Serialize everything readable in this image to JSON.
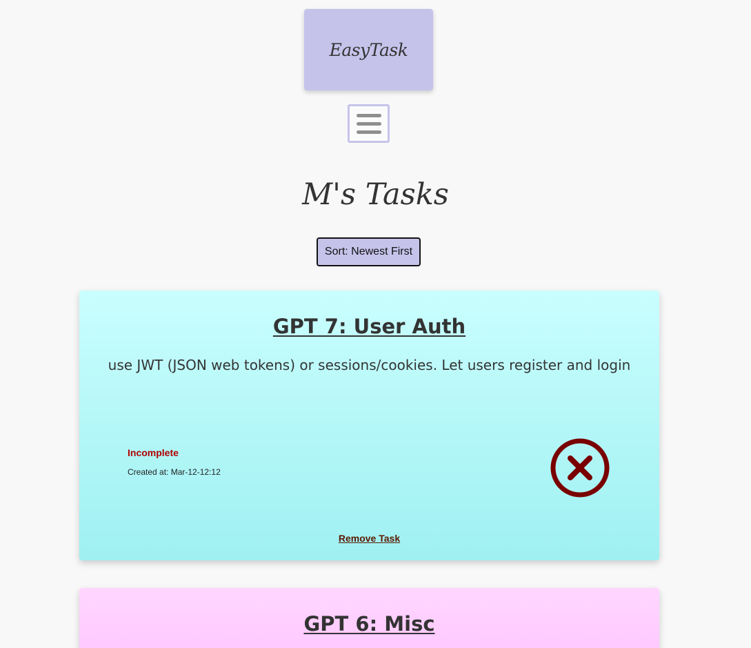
{
  "header": {
    "brand": "EasyTask",
    "menu_icon": "hamburger-menu-icon"
  },
  "page": {
    "title": "M's Tasks",
    "sort_label": "Sort: Newest First"
  },
  "tasks": [
    {
      "title": "GPT 7: User Auth",
      "description": "use JWT (JSON web tokens) or sessions/cookies. Let users register and login",
      "status": "Incomplete",
      "created": "Created at: Mar-12-12:12",
      "toggle_icon": "close-circle-icon",
      "remove_label": "Remove Task",
      "color": "#aef4f6"
    },
    {
      "title": "GPT 6: Misc",
      "color": "#ffc8ff"
    }
  ],
  "colors": {
    "accent": "#c6c3eb",
    "status_incomplete": "#b00000",
    "icon_dark_red": "#7a0000"
  }
}
